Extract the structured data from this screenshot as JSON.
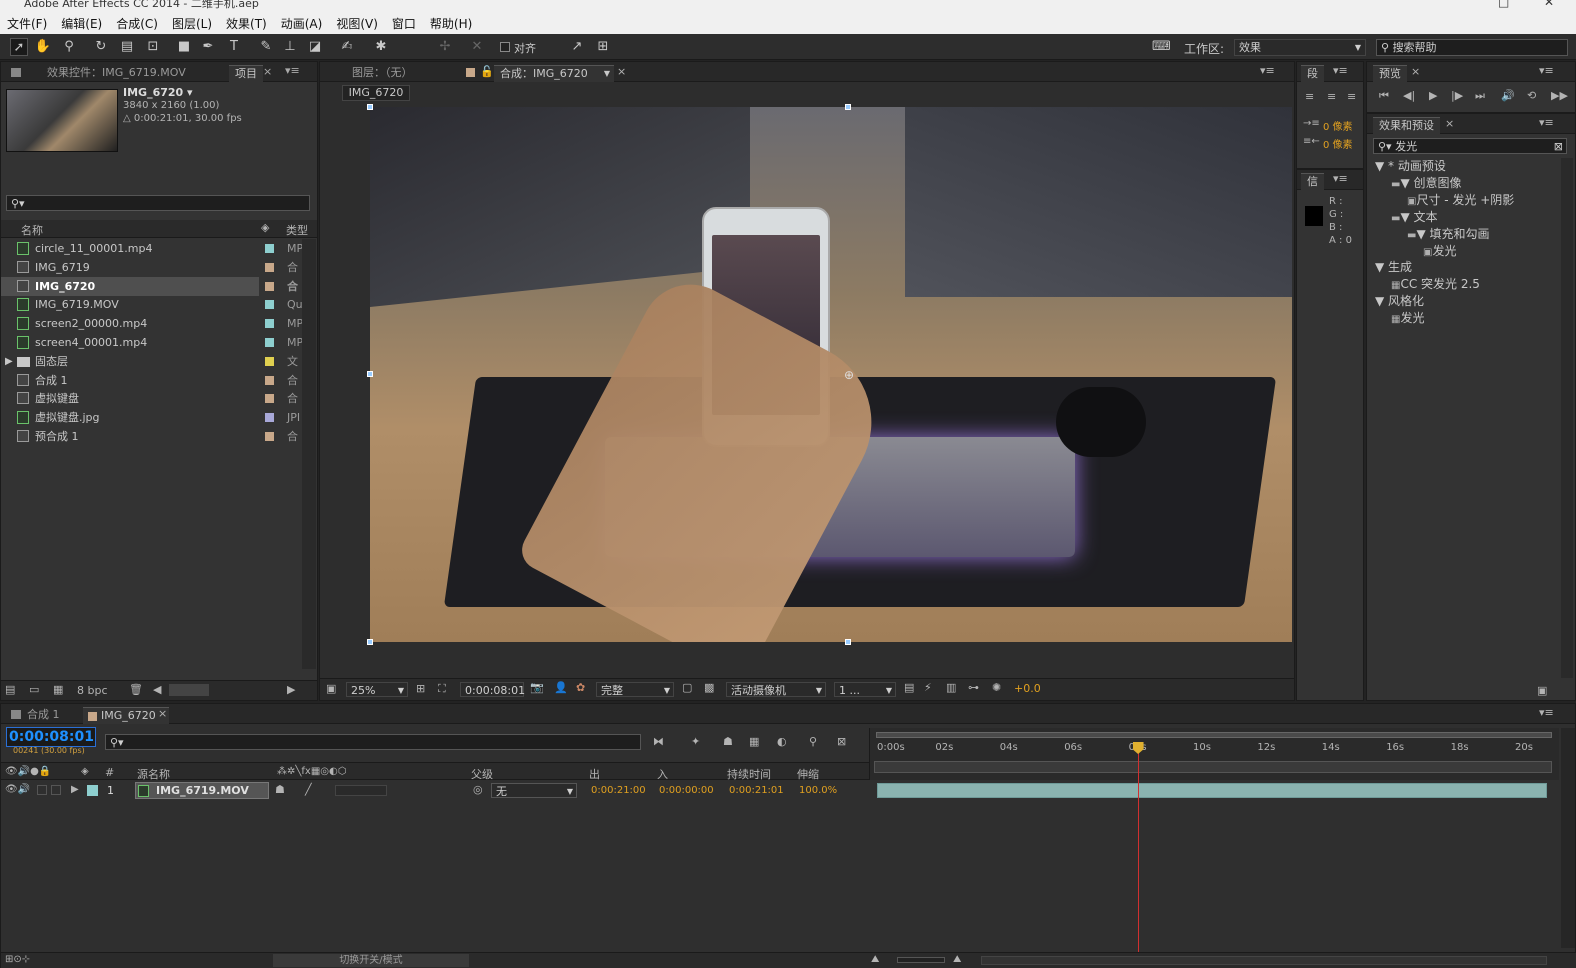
{
  "window": {
    "title": "Adobe After Effects CC 2014 - 二维手机.aep",
    "minimize": "−",
    "maximize": "□",
    "close": "✕"
  },
  "menu": [
    "文件(F)",
    "编辑(E)",
    "合成(C)",
    "图层(L)",
    "效果(T)",
    "动画(A)",
    "视图(V)",
    "窗口",
    "帮助(H)"
  ],
  "toolbar": {
    "snap_label": "对齐",
    "workspace_label": "工作区:",
    "workspace_value": "效果",
    "search_placeholder": "搜索帮助"
  },
  "project_panel": {
    "tab_effects": "效果控件：IMG_6719.MOV",
    "tab_project": "项目",
    "item_name": "IMG_6720 ▾",
    "item_size": "3840 x 2160 (1.00)",
    "item_duration": "△ 0:00:21:01, 30.00 fps",
    "col_name": "名称",
    "col_type": "类型",
    "bpc": "8 bpc",
    "items": [
      {
        "name": "circle_11_00001.mp4",
        "type": "MP",
        "color": "#8ecfcf",
        "kind": "file"
      },
      {
        "name": "IMG_6719",
        "type": "合",
        "color": "#c8a88a",
        "kind": "comp"
      },
      {
        "name": "IMG_6720",
        "type": "合",
        "color": "#c8a88a",
        "kind": "comp",
        "selected": true
      },
      {
        "name": "IMG_6719.MOV",
        "type": "Qu",
        "color": "#8ecfcf",
        "kind": "file"
      },
      {
        "name": "screen2_00000.mp4",
        "type": "MP",
        "color": "#8ecfcf",
        "kind": "file"
      },
      {
        "name": "screen4_00001.mp4",
        "type": "MP",
        "color": "#8ecfcf",
        "kind": "file"
      },
      {
        "name": "固态层",
        "type": "文",
        "color": "#e0d050",
        "kind": "folder"
      },
      {
        "name": "合成 1",
        "type": "合",
        "color": "#c8a88a",
        "kind": "comp"
      },
      {
        "name": "虚拟键盘",
        "type": "合",
        "color": "#c8a88a",
        "kind": "comp"
      },
      {
        "name": "虚拟键盘.jpg",
        "type": "JPI",
        "color": "#a8a8d8",
        "kind": "file"
      },
      {
        "name": "预合成 1",
        "type": "合",
        "color": "#c8a88a",
        "kind": "comp"
      }
    ]
  },
  "comp_panel": {
    "tab_layer": "图层：（无）",
    "tab_comp": "合成：IMG_6720",
    "crumb": "IMG_6720",
    "zoom": "25%",
    "timecode": "0:00:08:01",
    "quality": "完整",
    "camera": "活动摄像机",
    "views": "1 ...",
    "exposure": "+0.0"
  },
  "paragraph_panel": {
    "tab": "段",
    "indent1": "0 像素",
    "indent2": "0 像素"
  },
  "info_panel": {
    "tab": "信",
    "r": "R :",
    "g": "G :",
    "b": "B :",
    "a": "A : 0"
  },
  "preview_panel": {
    "tab": "预览"
  },
  "effects_panel": {
    "tab": "效果和预设",
    "search_value": "发光",
    "tree": [
      {
        "label": "▼ * 动画预设",
        "level": 0
      },
      {
        "label": "▼ 创意图像",
        "level": 1,
        "folder": true
      },
      {
        "label": "尺寸 - 发光 +阴影",
        "level": 2,
        "preset": true
      },
      {
        "label": "▼ 文本",
        "level": 1,
        "folder": true
      },
      {
        "label": "▼ 填充和勾画",
        "level": 2,
        "folder": true
      },
      {
        "label": "发光",
        "level": 3,
        "preset": true
      },
      {
        "label": "▼ 生成",
        "level": 0
      },
      {
        "label": "CC 突发光 2.5",
        "level": 1,
        "effect": true
      },
      {
        "label": "▼ 风格化",
        "level": 0
      },
      {
        "label": "发光",
        "level": 1,
        "effect": true
      }
    ]
  },
  "timeline": {
    "tab1": "合成 1",
    "tab2": "IMG_6720",
    "timecode": "0:00:08:01",
    "frame_info": "00241 (30.00 fps)",
    "columns": {
      "num": "#",
      "source": "源名称",
      "parent": "父级",
      "out": "出",
      "in": "入",
      "duration": "持续时间",
      "stretch": "伸缩"
    },
    "layer": {
      "index": "1",
      "name": "IMG_6719.MOV",
      "parent": "无",
      "out": "0:00:21:00",
      "in": "0:00:00:00",
      "duration": "0:00:21:01",
      "stretch": "100.0%",
      "color": "#8ecfcf"
    },
    "ticks": [
      "0:00s",
      "02s",
      "04s",
      "06s",
      "08s",
      "10s",
      "12s",
      "14s",
      "16s",
      "18s",
      "20s"
    ],
    "playhead_seconds": 8.03,
    "duration_seconds": 21.03,
    "footer": "切换开关/模式"
  },
  "colors": {
    "accent": "#e0a020",
    "timecode_blue": "#1e90ff",
    "playhead": "#d03030"
  }
}
